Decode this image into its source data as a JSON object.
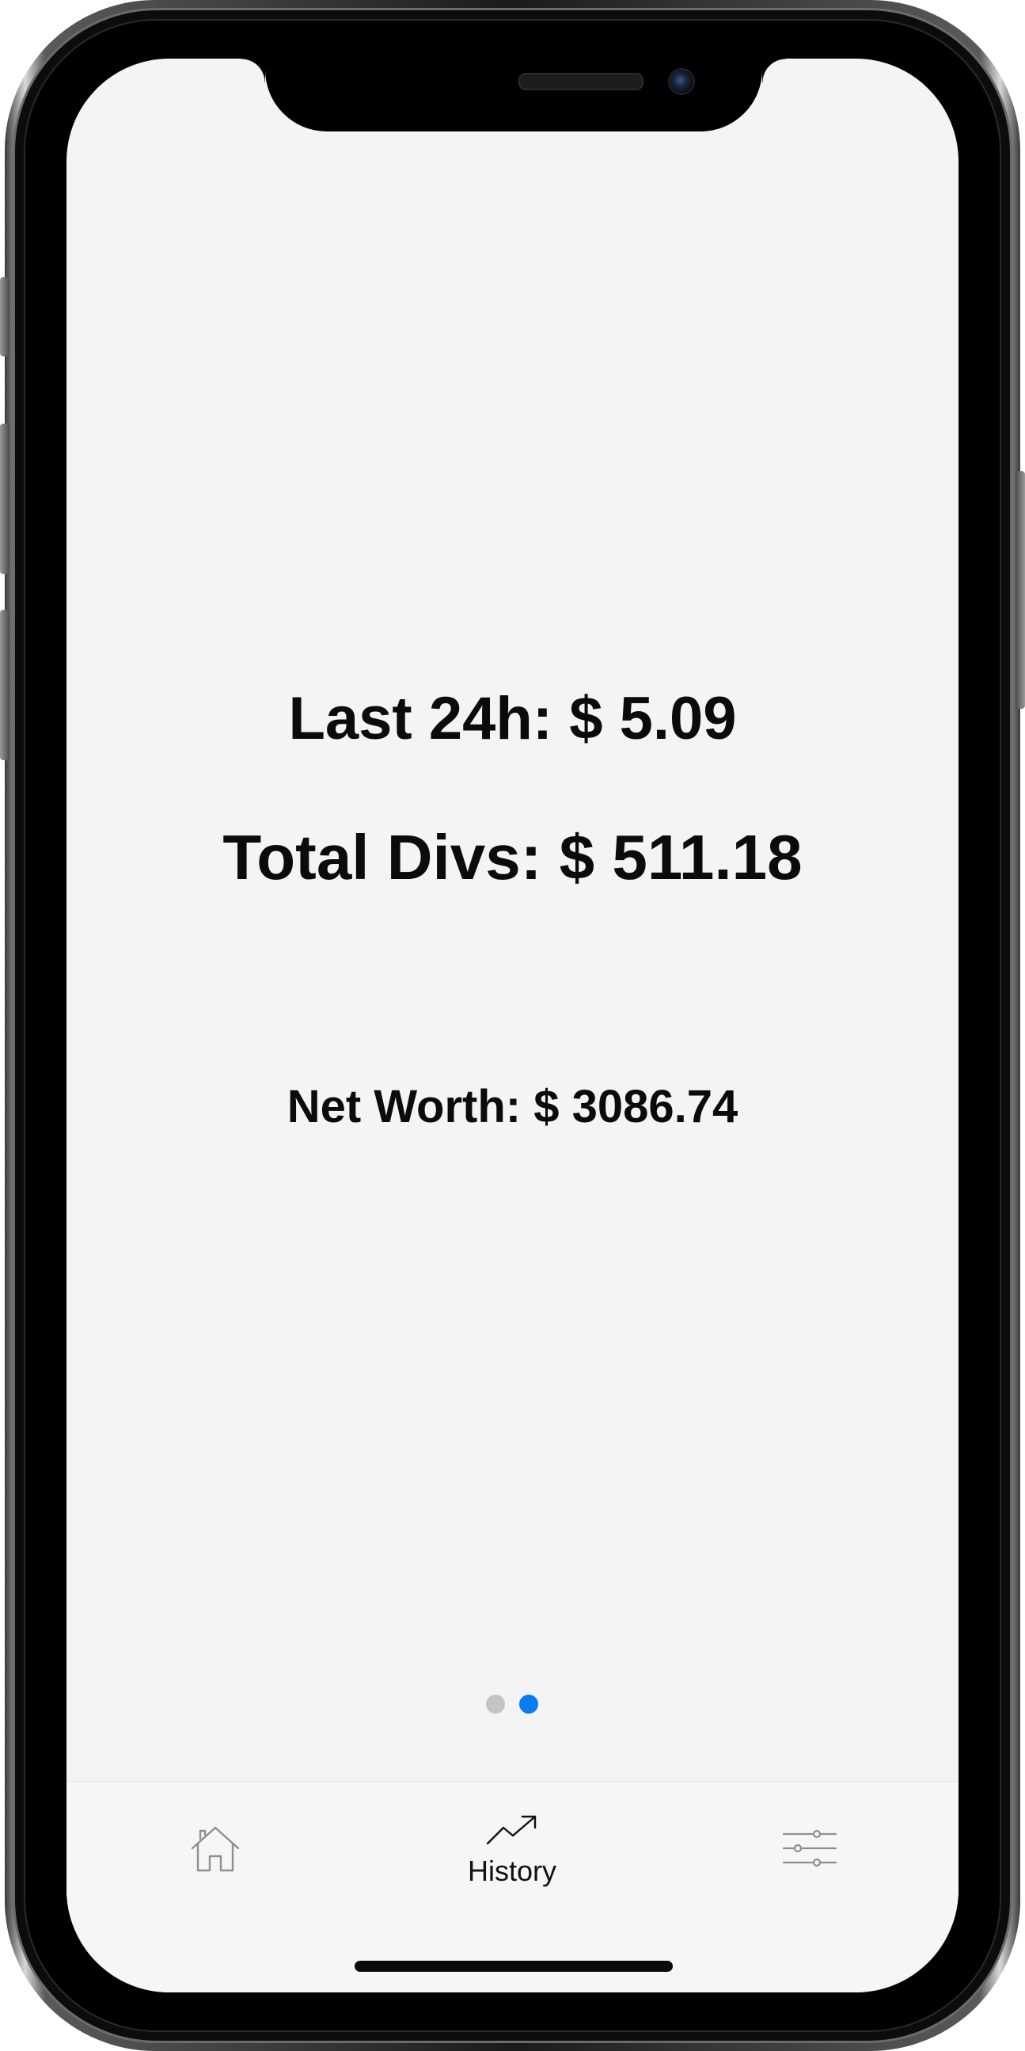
{
  "stats": {
    "last24h": "Last 24h: $ 5.09",
    "total_divs": "Total Divs: $ 511.18",
    "net_worth": "Net Worth: $ 3086.74"
  },
  "pager": {
    "page_count": 2,
    "current_page": 2,
    "active_color": "#0a7cf2",
    "inactive_color": "#c4c4c6"
  },
  "tabbar": {
    "tabs": [
      {
        "icon": "home-icon",
        "label": "",
        "selected": false
      },
      {
        "icon": "trending-up-icon",
        "label": "History",
        "selected": true
      },
      {
        "icon": "sliders-icon",
        "label": "",
        "selected": false
      }
    ]
  }
}
